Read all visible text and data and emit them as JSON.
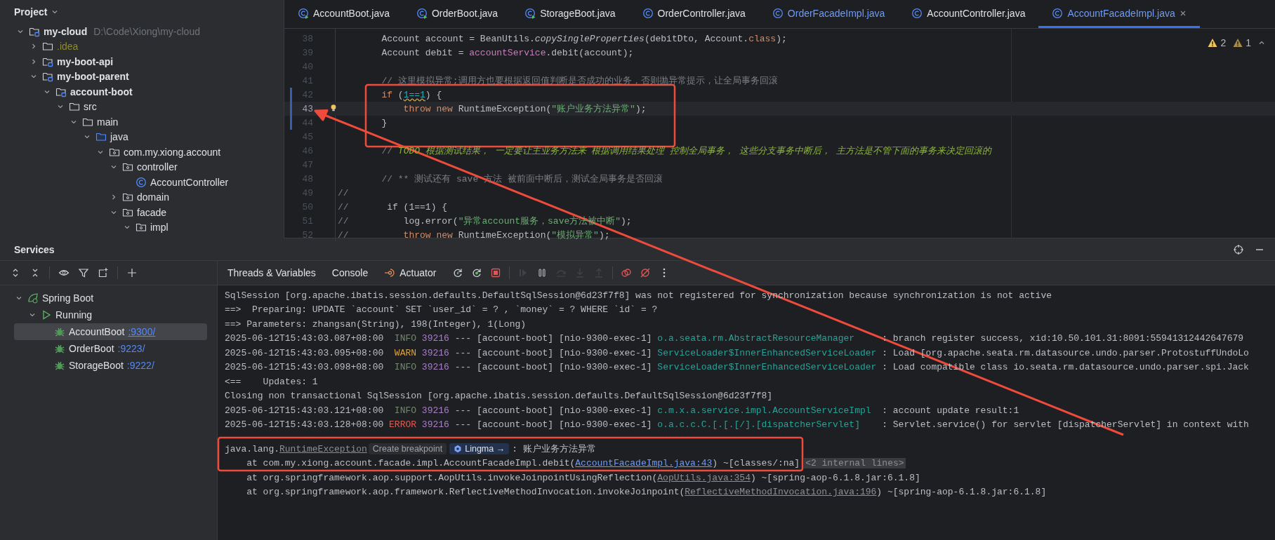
{
  "project_panel": {
    "title": "Project",
    "tree": [
      {
        "name": "my-cloud",
        "path": "D:\\Code\\Xiong\\my-cloud",
        "kind": "module",
        "expanded": true,
        "children": [
          {
            "name": ".idea",
            "kind": "excluded",
            "expanded": false
          },
          {
            "name": "my-boot-api",
            "kind": "module",
            "expanded": false
          },
          {
            "name": "my-boot-parent",
            "kind": "module",
            "expanded": true,
            "children": [
              {
                "name": "account-boot",
                "kind": "module",
                "expanded": true,
                "children": [
                  {
                    "name": "src",
                    "kind": "folder",
                    "expanded": true,
                    "children": [
                      {
                        "name": "main",
                        "kind": "folder",
                        "expanded": true,
                        "children": [
                          {
                            "name": "java",
                            "kind": "source",
                            "expanded": true,
                            "children": [
                              {
                                "name": "com.my.xiong.account",
                                "kind": "package",
                                "expanded": true,
                                "children": [
                                  {
                                    "name": "controller",
                                    "kind": "package",
                                    "expanded": true,
                                    "children": [
                                      {
                                        "name": "AccountController",
                                        "kind": "class"
                                      }
                                    ]
                                  },
                                  {
                                    "name": "domain",
                                    "kind": "package",
                                    "expanded": false
                                  },
                                  {
                                    "name": "facade",
                                    "kind": "package",
                                    "expanded": true,
                                    "children": [
                                      {
                                        "name": "impl",
                                        "kind": "package",
                                        "expanded": true
                                      }
                                    ]
                                  }
                                ]
                              }
                            ]
                          }
                        ]
                      }
                    ]
                  }
                ]
              }
            ]
          }
        ]
      }
    ]
  },
  "editor": {
    "tabs": [
      {
        "label": "AccountBoot.java",
        "kind": "runnable",
        "modified": false,
        "selected": false
      },
      {
        "label": "OrderBoot.java",
        "kind": "runnable",
        "modified": false,
        "selected": false
      },
      {
        "label": "StorageBoot.java",
        "kind": "runnable",
        "modified": false,
        "selected": false
      },
      {
        "label": "OrderController.java",
        "kind": "class",
        "modified": false,
        "selected": false
      },
      {
        "label": "OrderFacadeImpl.java",
        "kind": "class",
        "modified": true,
        "selected": false
      },
      {
        "label": "AccountController.java",
        "kind": "class",
        "modified": false,
        "selected": false
      },
      {
        "label": "AccountFacadeImpl.java",
        "kind": "class",
        "modified": true,
        "selected": true
      }
    ],
    "inspections": {
      "warnings": "2",
      "weak_warnings": "1"
    },
    "lines": [
      {
        "number": "38",
        "current": false,
        "changed": false,
        "segments": [
          {
            "text": "        Account account = BeanUtils.",
            "kind": "plain"
          },
          {
            "text": "copySingleProperties",
            "kind": "static"
          },
          {
            "text": "(debitDto, Account.",
            "kind": "plain"
          },
          {
            "text": "class",
            "kind": "keyword"
          },
          {
            "text": ");",
            "kind": "plain"
          }
        ]
      },
      {
        "number": "39",
        "current": false,
        "changed": false,
        "segments": [
          {
            "text": "        Account debit = ",
            "kind": "plain"
          },
          {
            "text": "accountService",
            "kind": "field"
          },
          {
            "text": ".debit(account);",
            "kind": "plain"
          }
        ]
      },
      {
        "number": "40",
        "current": false,
        "changed": false
      },
      {
        "number": "41",
        "current": false,
        "changed": false,
        "segments": [
          {
            "text": "        // 这里模拟异常;调用方也要根据返回值判断是否成功的业务，否则抛异常提示，让全局事务回滚",
            "kind": "comment"
          }
        ]
      },
      {
        "number": "42",
        "current": false,
        "changed": true,
        "segments": [
          {
            "text": "        if",
            "kind": "keyword"
          },
          {
            "text": " (",
            "kind": "plain"
          },
          {
            "text": "1==1",
            "kind": "warning"
          },
          {
            "text": ") {",
            "kind": "plain"
          }
        ]
      },
      {
        "number": "43",
        "current": true,
        "changed": true,
        "segments": [
          {
            "text": "            throw new",
            "kind": "keyword"
          },
          {
            "text": " RuntimeException(",
            "kind": "plain"
          },
          {
            "text": "\"账户业务方法异常\"",
            "kind": "string"
          },
          {
            "text": ");",
            "kind": "plain"
          }
        ]
      },
      {
        "number": "44",
        "current": false,
        "changed": true,
        "segments": [
          {
            "text": "        }",
            "kind": "plain"
          }
        ]
      },
      {
        "number": "45",
        "current": false,
        "changed": false
      },
      {
        "number": "46",
        "current": false,
        "changed": false,
        "segments": [
          {
            "text": "        // ",
            "kind": "comment"
          },
          {
            "text": "TODO 根据测试结果， 一定要让主业务方法来 根据调用结果处理 控制全局事务， 这些分支事务中断后， 主方法是不管下面的事务来决定回滚的",
            "kind": "todo"
          }
        ]
      },
      {
        "number": "47",
        "current": false,
        "changed": false
      },
      {
        "number": "48",
        "current": false,
        "changed": false,
        "segments": [
          {
            "text": "        // ** 测试还有 save 方法 被前面中断后，测试全局事务是否回滚",
            "kind": "comment"
          }
        ]
      },
      {
        "number": "49",
        "current": false,
        "changed": false,
        "segments": [
          {
            "text": "//",
            "kind": "comment"
          }
        ]
      },
      {
        "number": "50",
        "current": false,
        "changed": false,
        "segments": [
          {
            "text": "//",
            "kind": "comment"
          },
          {
            "text": "       if (1==1) {",
            "kind": "plain"
          }
        ]
      },
      {
        "number": "51",
        "current": false,
        "changed": false,
        "segments": [
          {
            "text": "//",
            "kind": "comment"
          },
          {
            "text": "          log.error(",
            "kind": "plain"
          },
          {
            "text": "\"异常account服务，save方法被中断\"",
            "kind": "string"
          },
          {
            "text": ");",
            "kind": "plain"
          }
        ]
      },
      {
        "number": "52",
        "current": false,
        "changed": false,
        "segments": [
          {
            "text": "//",
            "kind": "comment"
          },
          {
            "text": "          throw new",
            "kind": "keyword"
          },
          {
            "text": " RuntimeException(",
            "kind": "plain"
          },
          {
            "text": "\"模拟异常\"",
            "kind": "string"
          },
          {
            "text": ");",
            "kind": "plain"
          }
        ]
      }
    ]
  },
  "services": {
    "title": "Services",
    "tree": [
      {
        "name": "Spring Boot",
        "kind": "group",
        "expanded": true,
        "children": [
          {
            "name": "Running",
            "kind": "status",
            "expanded": true,
            "children": [
              {
                "name": "AccountBoot",
                "port": ":9300/",
                "kind": "app",
                "selected": true
              },
              {
                "name": "OrderBoot",
                "port": ":9223/",
                "kind": "app",
                "selected": false
              },
              {
                "name": "StorageBoot",
                "port": ":9222/",
                "kind": "app",
                "selected": false
              }
            ]
          }
        ]
      }
    ]
  },
  "console": {
    "tabs": [
      {
        "label": "Threads & Variables",
        "kind": "text"
      },
      {
        "label": "Console",
        "kind": "text"
      },
      {
        "label": "Actuator",
        "kind": "actuator"
      }
    ],
    "toolbar": [
      {
        "kind": "rerun",
        "disabled": false
      },
      {
        "kind": "rerun-debug",
        "disabled": false
      },
      {
        "kind": "stop",
        "disabled": false
      },
      {
        "kind": "resume",
        "disabled": true
      },
      {
        "kind": "pause",
        "disabled": false
      },
      {
        "kind": "step-over",
        "disabled": true
      },
      {
        "kind": "step-into",
        "disabled": true
      },
      {
        "kind": "step-out",
        "disabled": true
      },
      {
        "kind": "breakpoints",
        "disabled": false
      },
      {
        "kind": "mute-breakpoints",
        "disabled": false
      },
      {
        "kind": "more",
        "disabled": false
      }
    ],
    "log_lines": [
      [
        {
          "text": "SqlSession [org.apache.ibatis.session.defaults.DefaultSqlSession@6d23f7f8] was not registered for synchronization because synchronization is not active",
          "kind": "plain"
        }
      ],
      [
        {
          "text": "==>  Preparing: UPDATE `account` SET `user_id` = ? , `money` = ? WHERE `id` = ?",
          "kind": "plain"
        }
      ],
      [
        {
          "text": "==> Parameters: zhangsan(String), 198(Integer), 1(Long)",
          "kind": "plain"
        }
      ],
      [
        {
          "text": "2025-06-12T15:43:03.087+08:00  ",
          "kind": "plain"
        },
        {
          "text": "INFO",
          "kind": "info"
        },
        {
          "text": "39216",
          "kind": "pid"
        },
        {
          "text": " --- [account-boot] [nio-9300-exec-1] ",
          "kind": "plain"
        },
        {
          "text": "o.a.seata.rm.AbstractResourceManager",
          "kind": "logger"
        },
        {
          "text": "     : branch register success, xid:10.50.101.31:8091:55941312442647679",
          "kind": "plain"
        }
      ],
      [
        {
          "text": "2025-06-12T15:43:03.095+08:00  ",
          "kind": "plain"
        },
        {
          "text": "WARN",
          "kind": "warn"
        },
        {
          "text": "39216",
          "kind": "pid"
        },
        {
          "text": " --- [account-boot] [nio-9300-exec-1] ",
          "kind": "plain"
        },
        {
          "text": "ServiceLoader$InnerEnhancedServiceLoader",
          "kind": "logger"
        },
        {
          "text": " : Load [org.apache.seata.rm.datasource.undo.parser.ProtostuffUndoLo",
          "kind": "plain"
        }
      ],
      [
        {
          "text": "2025-06-12T15:43:03.098+08:00  ",
          "kind": "plain"
        },
        {
          "text": "INFO",
          "kind": "info"
        },
        {
          "text": "39216",
          "kind": "pid"
        },
        {
          "text": " --- [account-boot] [nio-9300-exec-1] ",
          "kind": "plain"
        },
        {
          "text": "ServiceLoader$InnerEnhancedServiceLoader",
          "kind": "logger"
        },
        {
          "text": " : Load compatible class io.seata.rm.datasource.undo.parser.spi.Jack",
          "kind": "plain"
        }
      ],
      [
        {
          "text": "<==    Updates: 1",
          "kind": "plain"
        }
      ],
      [
        {
          "text": "Closing non transactional SqlSession [org.apache.ibatis.session.defaults.DefaultSqlSession@6d23f7f8]",
          "kind": "plain"
        }
      ],
      [
        {
          "text": "2025-06-12T15:43:03.121+08:00  ",
          "kind": "plain"
        },
        {
          "text": "INFO",
          "kind": "info"
        },
        {
          "text": "39216",
          "kind": "pid"
        },
        {
          "text": " --- [account-boot] [nio-9300-exec-1] ",
          "kind": "plain"
        },
        {
          "text": "c.m.x.a.service.impl.AccountServiceImpl",
          "kind": "logger"
        },
        {
          "text": "  : account update result:1",
          "kind": "plain"
        }
      ],
      [
        {
          "text": "2025-06-12T15:43:03.128+08:00 ",
          "kind": "plain"
        },
        {
          "text": "ERROR",
          "kind": "error"
        },
        {
          "text": "39216",
          "kind": "pid"
        },
        {
          "text": " --- [account-boot] [nio-9300-exec-1] ",
          "kind": "plain"
        },
        {
          "text": "o.a.c.c.C.[.[.[/].[dispatcherServlet]",
          "kind": "logger"
        },
        {
          "text": "    : Servlet.service() for servlet [dispatcherServlet] in context with",
          "kind": "plain"
        }
      ]
    ],
    "stack_trace": [
      [
        {
          "text": "java.lang.",
          "kind": "plain"
        },
        {
          "text": "RuntimeException",
          "kind": "lib-link"
        },
        {
          "text": "Create breakpoint",
          "kind": "button"
        },
        {
          "text": "Lingma →",
          "kind": "assistant"
        },
        {
          "text": ": 账户业务方法异常",
          "kind": "plain"
        }
      ],
      [
        {
          "text": "    at com.my.xiong.account.facade.impl.AccountFacadeImpl.debit(",
          "kind": "plain"
        },
        {
          "text": "AccountFacadeImpl.java:43",
          "kind": "link"
        },
        {
          "text": ") ~[classes/:na]",
          "kind": "plain"
        },
        {
          "text": "<2 internal lines>",
          "kind": "fold"
        }
      ],
      [
        {
          "text": "    at org.springframework.aop.support.AopUtils.invokeJoinpointUsingReflection(",
          "kind": "plain"
        },
        {
          "text": "AopUtils.java:354",
          "kind": "lib-link"
        },
        {
          "text": ") ~[spring-aop-6.1.8.jar:6.1.8]",
          "kind": "plain"
        }
      ],
      [
        {
          "text": "    at org.springframework.aop.framework.ReflectiveMethodInvocation.invokeJoinpoint(",
          "kind": "plain"
        },
        {
          "text": "ReflectiveMethodInvocation.java:196",
          "kind": "lib-link"
        },
        {
          "text": ") ~[spring-aop-6.1.8.jar:6.1.8]",
          "kind": "plain"
        }
      ]
    ]
  }
}
